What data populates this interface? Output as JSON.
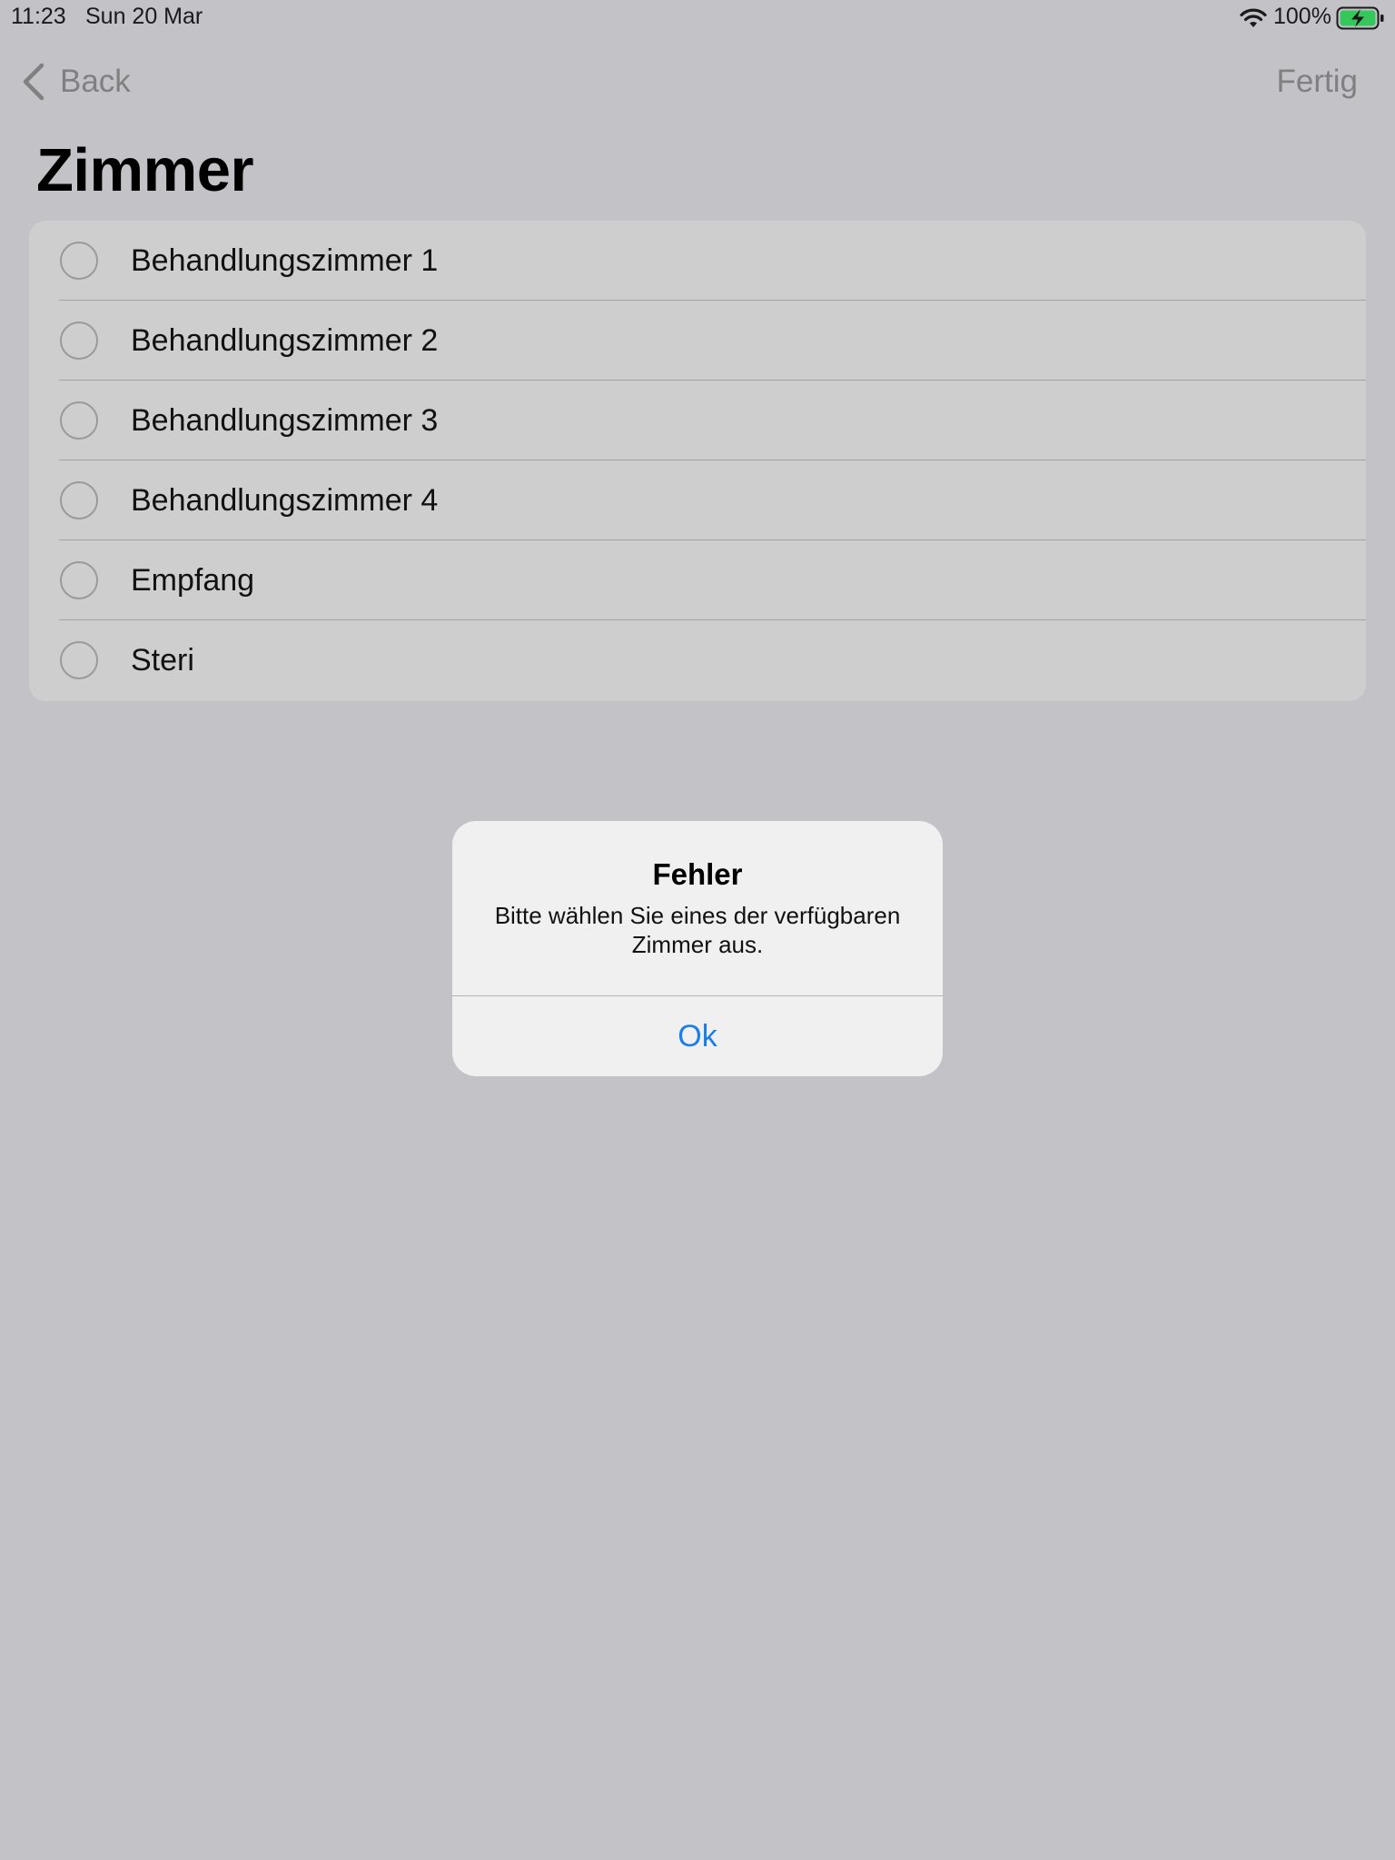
{
  "status_bar": {
    "time": "11:23",
    "date": "Sun 20 Mar",
    "battery": "100%",
    "icons": [
      "wifi-icon",
      "battery-charging-icon"
    ]
  },
  "nav": {
    "back_label": "Back",
    "done_label": "Fertig"
  },
  "title": "Zimmer",
  "rooms": [
    {
      "label": "Behandlungszimmer 1",
      "selected": false
    },
    {
      "label": "Behandlungszimmer 2",
      "selected": false
    },
    {
      "label": "Behandlungszimmer 3",
      "selected": false
    },
    {
      "label": "Behandlungszimmer 4",
      "selected": false
    },
    {
      "label": "Empfang",
      "selected": false
    },
    {
      "label": "Steri",
      "selected": false
    }
  ],
  "alert": {
    "title": "Fehler",
    "message": "Bitte wählen Sie eines der verfügbaren Zimmer aus.",
    "button_label": "Ok"
  },
  "colors": {
    "background": "#c3c2c7",
    "list_background": "#cecece",
    "alert_background": "#f0f0f1",
    "accent": "#1a7ee6",
    "battery_green": "#34c759",
    "inactive_nav": "#808080"
  }
}
